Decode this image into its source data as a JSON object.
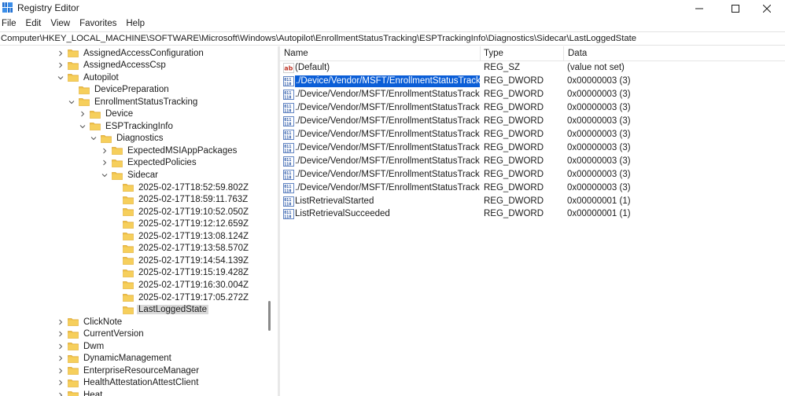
{
  "window": {
    "title": "Registry Editor"
  },
  "menu": [
    "File",
    "Edit",
    "View",
    "Favorites",
    "Help"
  ],
  "address": "Computer\\HKEY_LOCAL_MACHINE\\SOFTWARE\\Microsoft\\Windows\\Autopilot\\EnrollmentStatusTracking\\ESPTrackingInfo\\Diagnostics\\Sidecar\\LastLoggedState",
  "tree": [
    {
      "label": "AssignedAccessConfiguration",
      "expander": "right"
    },
    {
      "label": "AssignedAccessCsp",
      "expander": "right"
    },
    {
      "label": "Autopilot",
      "expander": "down"
    },
    {
      "label": "DevicePreparation",
      "expander": "none"
    },
    {
      "label": "EnrollmentStatusTracking",
      "expander": "down"
    },
    {
      "label": "Device",
      "expander": "right"
    },
    {
      "label": "ESPTrackingInfo",
      "expander": "down"
    },
    {
      "label": "Diagnostics",
      "expander": "down"
    },
    {
      "label": "ExpectedMSIAppPackages",
      "expander": "right"
    },
    {
      "label": "ExpectedPolicies",
      "expander": "right"
    },
    {
      "label": "Sidecar",
      "expander": "down"
    },
    {
      "label": "2025-02-17T18:52:59.802Z",
      "expander": "none"
    },
    {
      "label": "2025-02-17T18:59:11.763Z",
      "expander": "none"
    },
    {
      "label": "2025-02-17T19:10:52.050Z",
      "expander": "none"
    },
    {
      "label": "2025-02-17T19:12:12.659Z",
      "expander": "none"
    },
    {
      "label": "2025-02-17T19:13:08.124Z",
      "expander": "none"
    },
    {
      "label": "2025-02-17T19:13:58.570Z",
      "expander": "none"
    },
    {
      "label": "2025-02-17T19:14:54.139Z",
      "expander": "none"
    },
    {
      "label": "2025-02-17T19:15:19.428Z",
      "expander": "none"
    },
    {
      "label": "2025-02-17T19:16:30.004Z",
      "expander": "none"
    },
    {
      "label": "2025-02-17T19:17:05.272Z",
      "expander": "none"
    },
    {
      "label": "LastLoggedState",
      "expander": "none",
      "selected": true
    },
    {
      "label": "ClickNote",
      "expander": "right"
    },
    {
      "label": "CurrentVersion",
      "expander": "right"
    },
    {
      "label": "Dwm",
      "expander": "right"
    },
    {
      "label": "DynamicManagement",
      "expander": "right"
    },
    {
      "label": "EnterpriseResourceManager",
      "expander": "right"
    },
    {
      "label": "HealthAttestationAttestClient",
      "expander": "right"
    },
    {
      "label": "Heat",
      "expander": "right"
    }
  ],
  "columns": {
    "name": "Name",
    "type": "Type",
    "data": "Data"
  },
  "values": [
    {
      "icon": "string-value-icon",
      "name": "(Default)",
      "type": "REG_SZ",
      "data": "(value not set)"
    },
    {
      "icon": "binary-value-icon",
      "name": "./Device/Vendor/MSFT/EnrollmentStatusTracking...",
      "type": "REG_DWORD",
      "data": "0x00000003 (3)",
      "selected": true
    },
    {
      "icon": "binary-value-icon",
      "name": "./Device/Vendor/MSFT/EnrollmentStatusTracking...",
      "type": "REG_DWORD",
      "data": "0x00000003 (3)"
    },
    {
      "icon": "binary-value-icon",
      "name": "./Device/Vendor/MSFT/EnrollmentStatusTracking...",
      "type": "REG_DWORD",
      "data": "0x00000003 (3)"
    },
    {
      "icon": "binary-value-icon",
      "name": "./Device/Vendor/MSFT/EnrollmentStatusTracking...",
      "type": "REG_DWORD",
      "data": "0x00000003 (3)"
    },
    {
      "icon": "binary-value-icon",
      "name": "./Device/Vendor/MSFT/EnrollmentStatusTracking...",
      "type": "REG_DWORD",
      "data": "0x00000003 (3)"
    },
    {
      "icon": "binary-value-icon",
      "name": "./Device/Vendor/MSFT/EnrollmentStatusTracking...",
      "type": "REG_DWORD",
      "data": "0x00000003 (3)"
    },
    {
      "icon": "binary-value-icon",
      "name": "./Device/Vendor/MSFT/EnrollmentStatusTracking...",
      "type": "REG_DWORD",
      "data": "0x00000003 (3)"
    },
    {
      "icon": "binary-value-icon",
      "name": "./Device/Vendor/MSFT/EnrollmentStatusTracking...",
      "type": "REG_DWORD",
      "data": "0x00000003 (3)"
    },
    {
      "icon": "binary-value-icon",
      "name": "./Device/Vendor/MSFT/EnrollmentStatusTracking...",
      "type": "REG_DWORD",
      "data": "0x00000003 (3)"
    },
    {
      "icon": "binary-value-icon",
      "name": "ListRetrievalStarted",
      "type": "REG_DWORD",
      "data": "0x00000001 (1)"
    },
    {
      "icon": "binary-value-icon",
      "name": "ListRetrievalSucceeded",
      "type": "REG_DWORD",
      "data": "0x00000001 (1)"
    }
  ],
  "colors": {
    "selection": "#0b5ed7",
    "folder": "#f0c24a",
    "tree_selection": "#d9d9d9"
  }
}
